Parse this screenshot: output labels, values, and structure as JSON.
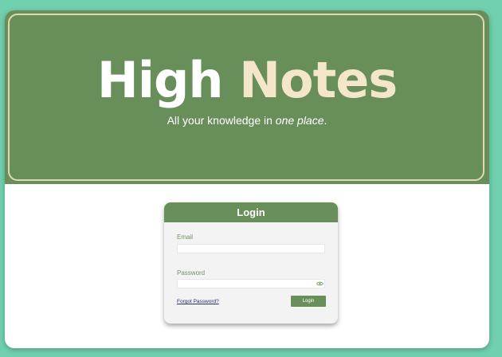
{
  "hero": {
    "title_part1": "High",
    "title_part2": "Notes",
    "tagline_prefix": "All your knowledge in ",
    "tagline_emphasis": "one place",
    "tagline_suffix": "."
  },
  "login": {
    "header": "Login",
    "email_label": "Email",
    "email_value": "",
    "password_label": "Password",
    "password_value": "",
    "forgot_link": "Forgot Password?",
    "submit_label": "Login"
  },
  "colors": {
    "background": "#6fcfae",
    "brand_green": "#688f5a",
    "accent_cream": "#f4e6c9",
    "card_bg": "#f3f3f3"
  },
  "icons": {
    "password_toggle": "eye-icon"
  }
}
